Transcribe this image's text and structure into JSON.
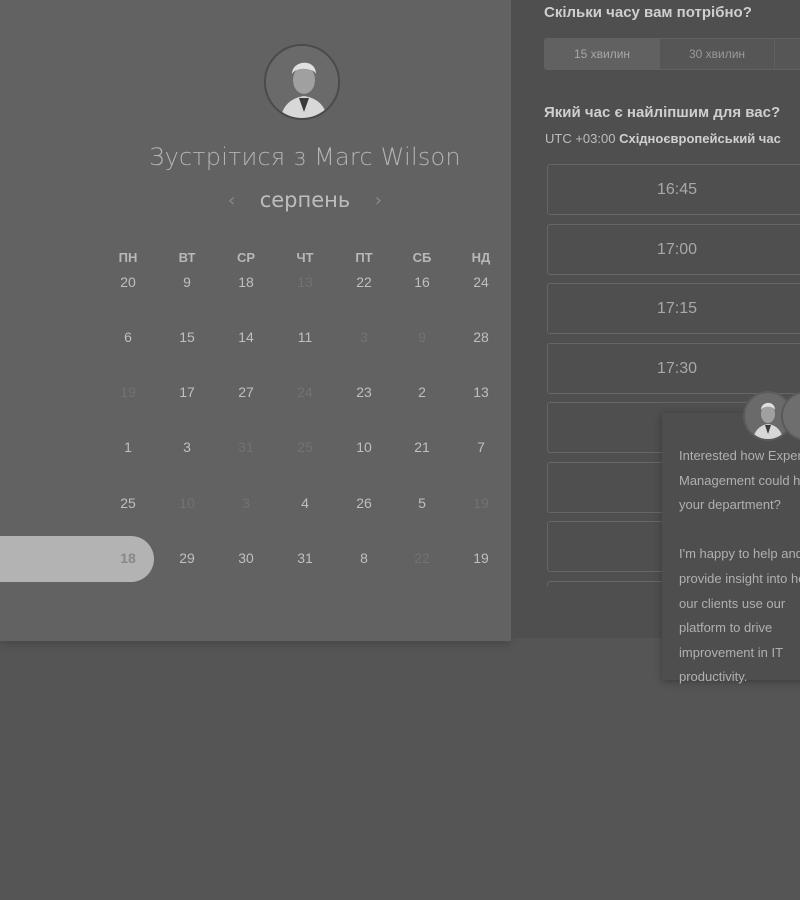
{
  "host": {
    "title": "Зустрітися з Marc Wilson"
  },
  "calendar": {
    "month": "серпень",
    "prev_icon": "chevron-left-icon",
    "next_icon": "chevron-right-icon",
    "weekdays": [
      "ПН",
      "ВТ",
      "СР",
      "ЧТ",
      "ПТ",
      "СБ",
      "НД"
    ],
    "weeks": [
      [
        {
          "d": "20",
          "dim": false
        },
        {
          "d": "9",
          "dim": false
        },
        {
          "d": "18",
          "dim": false
        },
        {
          "d": "13",
          "dim": true
        },
        {
          "d": "22",
          "dim": false
        },
        {
          "d": "16",
          "dim": false
        },
        {
          "d": "24",
          "dim": false
        }
      ],
      [
        {
          "d": "6",
          "dim": false
        },
        {
          "d": "15",
          "dim": false
        },
        {
          "d": "14",
          "dim": false
        },
        {
          "d": "11",
          "dim": false
        },
        {
          "d": "3",
          "dim": true
        },
        {
          "d": "9",
          "dim": true
        },
        {
          "d": "28",
          "dim": false
        }
      ],
      [
        {
          "d": "19",
          "dim": true
        },
        {
          "d": "17",
          "dim": false
        },
        {
          "d": "27",
          "dim": false
        },
        {
          "d": "24",
          "dim": true
        },
        {
          "d": "23",
          "dim": false
        },
        {
          "d": "2",
          "dim": false
        },
        {
          "d": "13",
          "dim": false
        }
      ],
      [
        {
          "d": "1",
          "dim": false
        },
        {
          "d": "3",
          "dim": false
        },
        {
          "d": "31",
          "dim": true
        },
        {
          "d": "25",
          "dim": true
        },
        {
          "d": "10",
          "dim": false
        },
        {
          "d": "21",
          "dim": false
        },
        {
          "d": "7",
          "dim": false
        }
      ],
      [
        {
          "d": "25",
          "dim": false
        },
        {
          "d": "10",
          "dim": true
        },
        {
          "d": "3",
          "dim": true
        },
        {
          "d": "4",
          "dim": false
        },
        {
          "d": "26",
          "dim": false
        },
        {
          "d": "5",
          "dim": false
        },
        {
          "d": "19",
          "dim": true
        }
      ],
      [
        {
          "d": "18",
          "dim": false,
          "selected": true
        },
        {
          "d": "29",
          "dim": false
        },
        {
          "d": "30",
          "dim": false
        },
        {
          "d": "31",
          "dim": false
        },
        {
          "d": "8",
          "dim": false
        },
        {
          "d": "22",
          "dim": true
        },
        {
          "d": "19",
          "dim": false
        }
      ]
    ]
  },
  "duration": {
    "title": "Скільки часу вам потрібно?",
    "options": [
      "15 хвилин",
      "30 хвилин"
    ]
  },
  "time": {
    "title": "Який час є найліпшим для вас?",
    "tz_offset": "UTC +03:00",
    "tz_name": "Східноєвропейський час",
    "slots": [
      "16:45",
      "17:00",
      "17:15",
      "17:30",
      "",
      "",
      "",
      ""
    ]
  },
  "chat": {
    "message": "Interested how Expert Management could help your department?\n\nI'm happy to help and provide insight into how our clients use our platform to drive improvement in IT productivity."
  }
}
